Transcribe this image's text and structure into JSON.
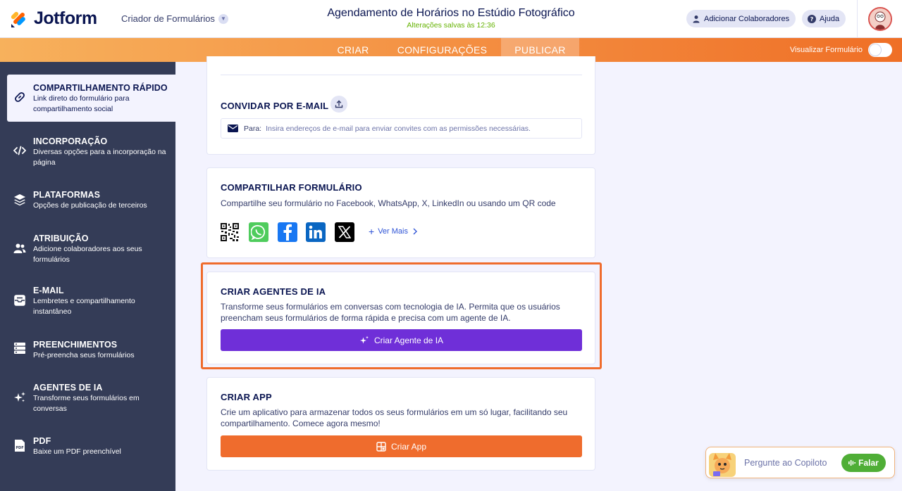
{
  "header": {
    "brand": "Jotform",
    "builder_label": "Criador de Formulários",
    "form_title": "Agendamento de Horários no Estúdio Fotográfico",
    "saved_status": "Alterações salvas às 12:36",
    "add_collaborators": "Adicionar Colaboradores",
    "help": "Ajuda"
  },
  "tabs": {
    "create": "CRIAR",
    "settings": "CONFIGURAÇÕES",
    "publish": "PUBLICAR",
    "preview_label": "Visualizar Formulário"
  },
  "sidebar": {
    "items": [
      {
        "title": "COMPARTILHAMENTO RÁPIDO",
        "desc": "Link direto do formulário para compartilhamento social",
        "icon": "link-icon"
      },
      {
        "title": "INCORPORAÇÃO",
        "desc": "Diversas opções para a incorporação na página",
        "icon": "code-icon"
      },
      {
        "title": "PLATAFORMAS",
        "desc": "Opções de publicação de terceiros",
        "icon": "layers-icon"
      },
      {
        "title": "ATRIBUIÇÃO",
        "desc": "Adicione colaboradores aos seus formulários",
        "icon": "users-icon"
      },
      {
        "title": "E-MAIL",
        "desc": "Lembretes e compartilhamento instantâneo",
        "icon": "mail-icon"
      },
      {
        "title": "PREENCHIMENTOS",
        "desc": "Pré-preencha seus formulários",
        "icon": "list-icon"
      },
      {
        "title": "AGENTES DE IA",
        "desc": "Transforme seus formulários em conversas",
        "icon": "sparkle-icon"
      },
      {
        "title": "PDF",
        "desc": "Baixe um PDF preenchível",
        "icon": "pdf-icon"
      }
    ]
  },
  "invite": {
    "title": "CONVIDAR POR E-MAIL",
    "to_label": "Para:",
    "placeholder": "Insira endereços de e-mail para enviar convites com as permissões necessárias."
  },
  "share": {
    "title": "COMPARTILHAR FORMULÁRIO",
    "desc": "Compartilhe seu formulário no Facebook, WhatsApp, X, LinkedIn ou usando um QR code",
    "see_more": "Ver Mais"
  },
  "ai_agents": {
    "title": "CRIAR AGENTES DE IA",
    "desc": "Transforme seus formulários em conversas com tecnologia de IA. Permita que os usuários preencham seus formulários de forma rápida e precisa com um agente de IA.",
    "button": "Criar Agente de IA"
  },
  "app": {
    "title": "CRIAR APP",
    "desc": "Crie um aplicativo para armazenar todos os seus formulários em um só lugar, facilitando seu compartilhamento. Comece agora mesmo!",
    "button": "Criar App"
  },
  "copilot": {
    "placeholder": "Pergunte ao Copiloto",
    "talk": "Falar"
  },
  "colors": {
    "orange": "#ef6c2d",
    "purple": "#6f2fd8",
    "sidebar": "#343c57",
    "green": "#64b200"
  }
}
